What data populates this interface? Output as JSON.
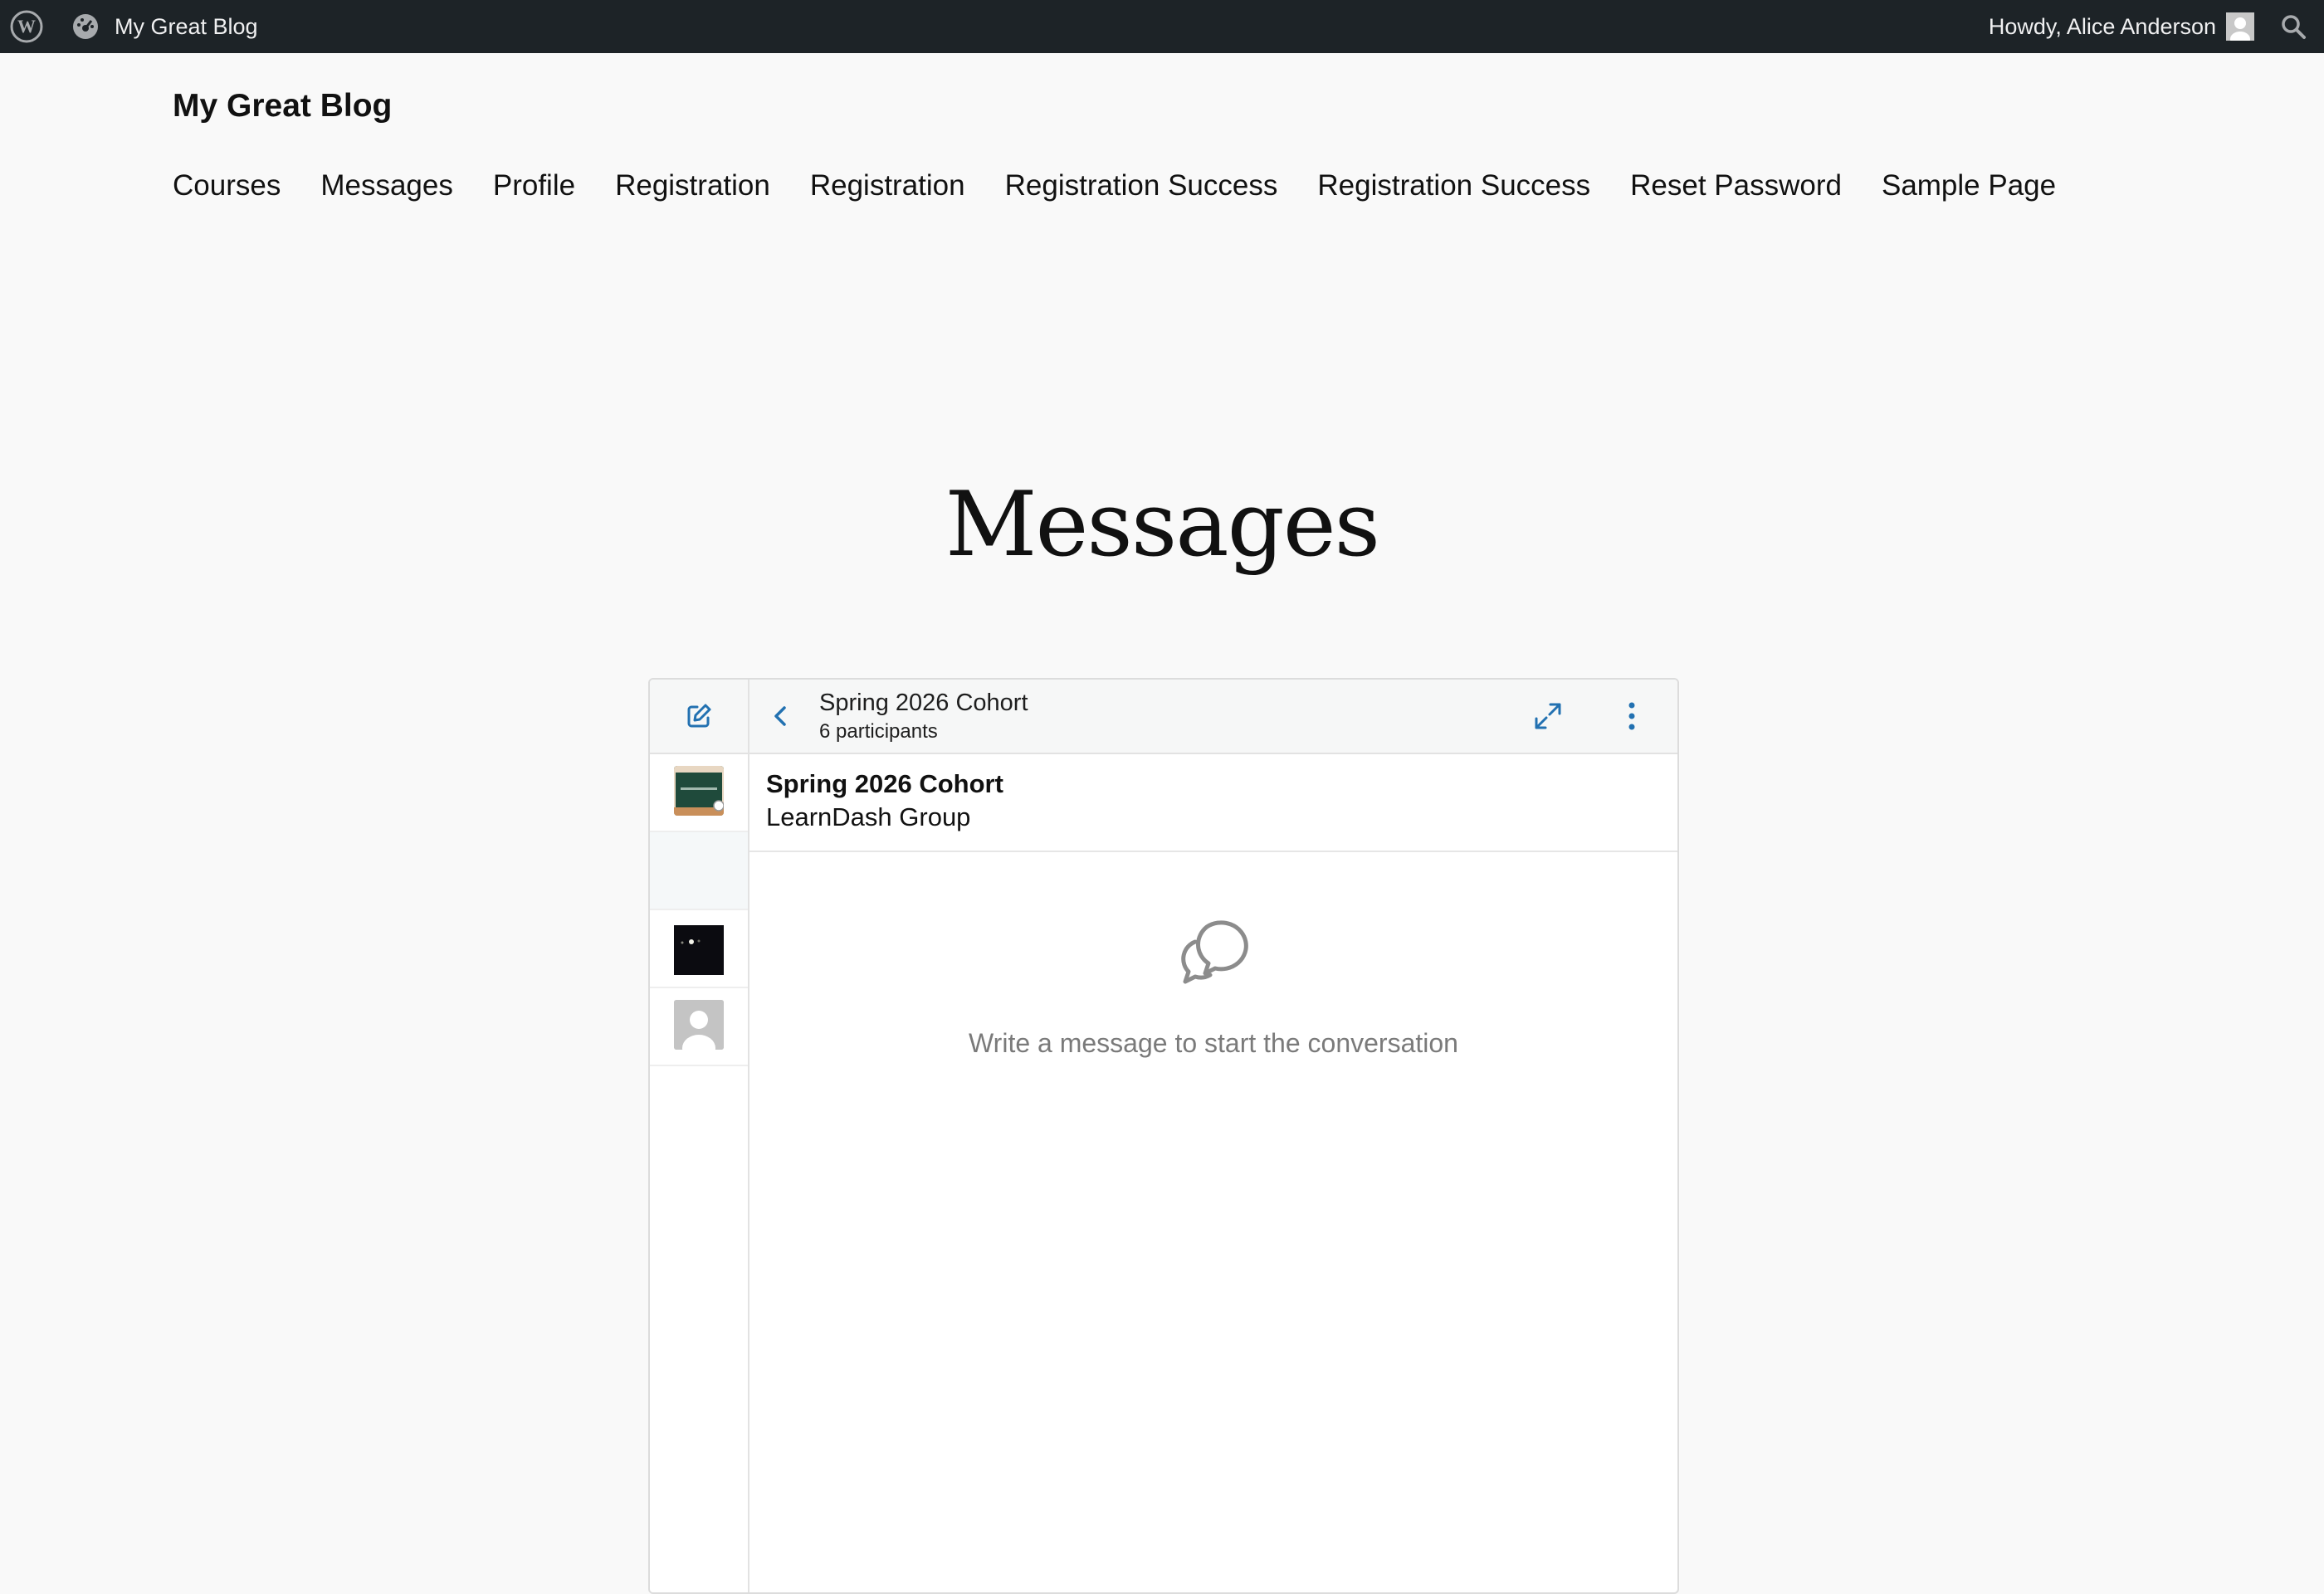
{
  "admin_bar": {
    "wp_logo_icon": "wordpress-icon",
    "site_name": "My Great Blog",
    "dashboard_icon": "dashboard-icon",
    "howdy": "Howdy, Alice Anderson",
    "search_icon": "search-icon"
  },
  "site": {
    "title": "My Great Blog",
    "nav": [
      "Courses",
      "Messages",
      "Profile",
      "Registration",
      "Registration",
      "Registration Success",
      "Registration Success",
      "Reset Password",
      "Sample Page"
    ]
  },
  "page": {
    "title": "Messages"
  },
  "messages": {
    "conversation": {
      "title": "Spring 2026 Cohort",
      "participants": "6 participants"
    },
    "header": {
      "name": "Spring 2026 Cohort",
      "group_type": "LearnDash Group"
    },
    "empty_state": "Write a message to start the conversation",
    "icons": {
      "compose": "compose-icon",
      "back": "chevron-left-icon",
      "expand": "expand-icon",
      "more": "more-vertical-icon",
      "empty": "chat-bubbles-icon"
    },
    "accent_color": "#2271b1"
  }
}
